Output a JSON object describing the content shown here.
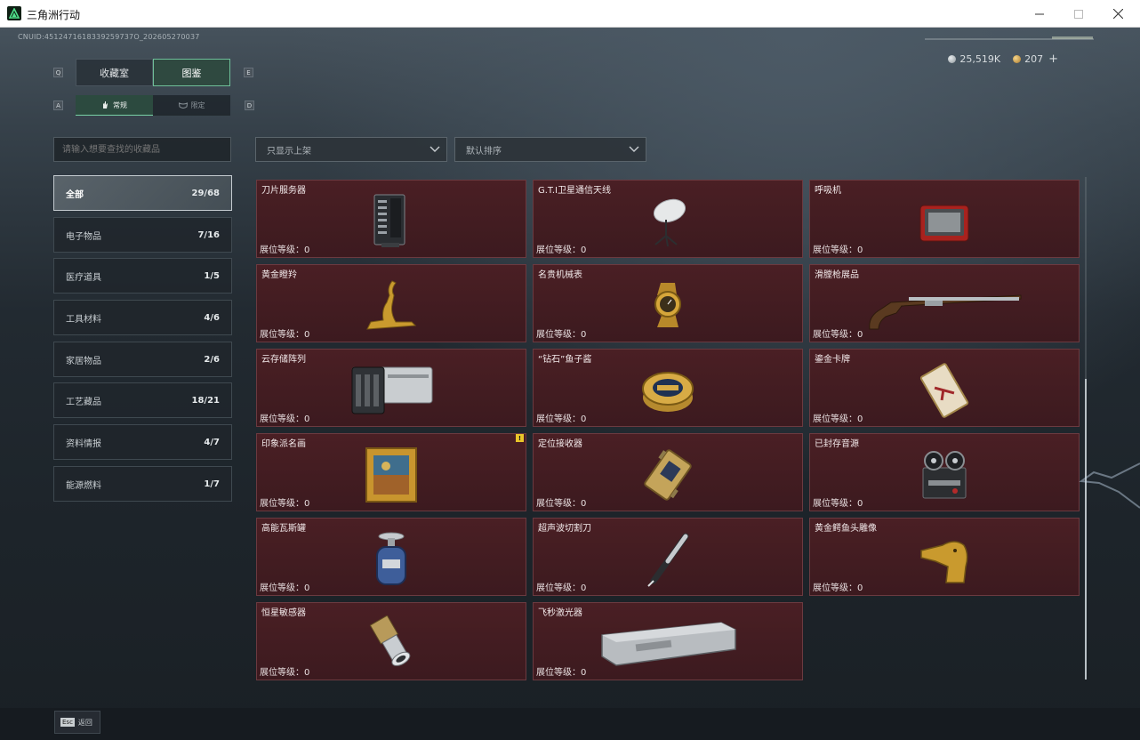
{
  "window": {
    "title": "三角洲行动",
    "minimize_icon": "minimize-icon",
    "maximize_icon": "maximize-icon",
    "close_icon": "close-icon"
  },
  "header": {
    "cnuid": "CNUID:4512471618339259737O_202605270037",
    "currency": [
      {
        "value": "25,519K",
        "icon": "silver-coin-icon",
        "color": "#b9c0c4"
      },
      {
        "value": "207",
        "icon": "gold-coin-icon",
        "color": "#d9a441"
      }
    ],
    "add_label": "+"
  },
  "tabs": {
    "left_key": "Q",
    "right_key": "E",
    "items": [
      {
        "label": "收藏室",
        "active": false
      },
      {
        "label": "图鉴",
        "active": true
      }
    ]
  },
  "subtabs": {
    "left_key": "A",
    "right_key": "D",
    "items": [
      {
        "label": "常规",
        "icon": "hand-icon",
        "active": true
      },
      {
        "label": "限定",
        "icon": "mask-icon",
        "active": false
      }
    ]
  },
  "search": {
    "placeholder": "请输入想要查找的收藏品",
    "value": ""
  },
  "filters": {
    "display": "只显示上架",
    "sort": "默认排序"
  },
  "categories": [
    {
      "label": "全部",
      "count": "29/68",
      "active": true
    },
    {
      "label": "电子物品",
      "count": "7/16"
    },
    {
      "label": "医疗道具",
      "count": "1/5"
    },
    {
      "label": "工具材料",
      "count": "4/6"
    },
    {
      "label": "家居物品",
      "count": "2/6"
    },
    {
      "label": "工艺藏品",
      "count": "18/21"
    },
    {
      "label": "资料情报",
      "count": "4/7"
    },
    {
      "label": "能源燃料",
      "count": "1/7"
    }
  ],
  "items": [
    {
      "name": "刀片服务器",
      "level": "展位等级：0",
      "icon": "server-icon"
    },
    {
      "name": "G.T.I卫星通信天线",
      "level": "展位等级：0",
      "icon": "satellite-dish-icon"
    },
    {
      "name": "呼吸机",
      "level": "展位等级：0",
      "icon": "ventilator-icon"
    },
    {
      "name": "黄金瞪羚",
      "level": "展位等级：0",
      "icon": "gazelle-statue-icon"
    },
    {
      "name": "名贵机械表",
      "level": "展位等级：0",
      "icon": "watch-icon"
    },
    {
      "name": "滑膛枪展品",
      "level": "展位等级：0",
      "icon": "musket-icon"
    },
    {
      "name": "云存储阵列",
      "level": "展位等级：0",
      "icon": "storage-array-icon"
    },
    {
      "name": "“钻石”鱼子酱",
      "level": "展位等级：0",
      "icon": "caviar-tin-icon"
    },
    {
      "name": "鎏金卡牌",
      "level": "展位等级：0",
      "icon": "card-icon"
    },
    {
      "name": "印象派名画",
      "level": "展位等级：0",
      "icon": "painting-icon",
      "warn": "!"
    },
    {
      "name": "定位接收器",
      "level": "展位等级：0",
      "icon": "gps-receiver-icon"
    },
    {
      "name": "已封存音源",
      "level": "展位等级：0",
      "icon": "reel-recorder-icon"
    },
    {
      "name": "高能瓦斯罐",
      "level": "展位等级：0",
      "icon": "gas-canister-icon"
    },
    {
      "name": "超声波切割刀",
      "level": "展位等级：0",
      "icon": "cutter-icon"
    },
    {
      "name": "黄金鳄鱼头雕像",
      "level": "展位等级：0",
      "icon": "crocodile-statue-icon"
    },
    {
      "name": "恒星敏感器",
      "level": "展位等级：0",
      "icon": "star-sensor-icon"
    },
    {
      "name": "飞秒激光器",
      "level": "展位等级：0",
      "icon": "laser-case-icon"
    }
  ],
  "footer": {
    "esc_key": "Esc",
    "back_label": "返回"
  }
}
